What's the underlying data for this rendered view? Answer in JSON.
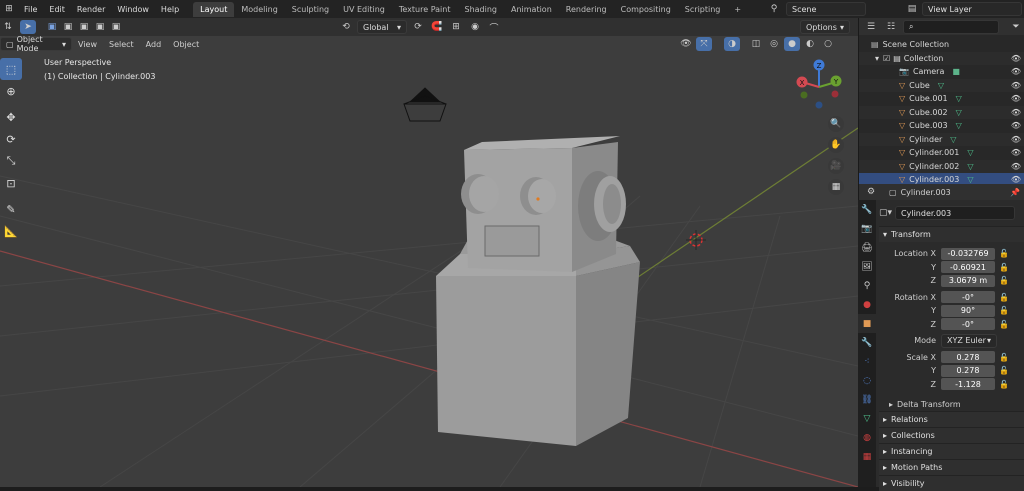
{
  "menu": {
    "items": [
      "File",
      "Edit",
      "Render",
      "Window",
      "Help"
    ]
  },
  "workspaces": {
    "tabs": [
      "Layout",
      "Modeling",
      "Sculpting",
      "UV Editing",
      "Texture Paint",
      "Shading",
      "Animation",
      "Rendering",
      "Compositing",
      "Scripting"
    ],
    "active": "Layout",
    "add": "+"
  },
  "scene": {
    "name": "Scene",
    "view_layer": "View Layer"
  },
  "header": {
    "mode": "Object Mode",
    "menus": [
      "View",
      "Select",
      "Add",
      "Object"
    ],
    "transform_orientation": "Global",
    "options": "Options"
  },
  "viewport": {
    "view_name": "User Perspective",
    "collection_info": "(1) Collection | Cylinder.003"
  },
  "gizmo": {
    "x": "X",
    "y": "Y",
    "z": "Z"
  },
  "outliner": {
    "search_placeholder": "",
    "root": "Scene Collection",
    "collection": "Collection",
    "items": [
      "Camera",
      "Cube",
      "Cube.001",
      "Cube.002",
      "Cube.003",
      "Cylinder",
      "Cylinder.001",
      "Cylinder.002",
      "Cylinder.003"
    ]
  },
  "properties": {
    "object_name": "Cylinder.003",
    "datablock_name": "Cylinder.003",
    "transform_title": "Transform",
    "location_label": "Location X",
    "location": {
      "x": "-0.032769",
      "y": "-0.60921",
      "z": "3.0679 m"
    },
    "rotation_label": "Rotation X",
    "rotation": {
      "x": "-0°",
      "y": "90°",
      "z": "-0°"
    },
    "mode_label": "Mode",
    "mode_value": "XYZ Euler",
    "scale_label": "Scale X",
    "scale": {
      "x": "0.278",
      "y": "0.278",
      "z": "-1.128"
    },
    "y_label": "Y",
    "z_label": "Z",
    "delta": "Delta Transform",
    "panels": [
      "Relations",
      "Collections",
      "Instancing",
      "Motion Paths",
      "Visibility"
    ]
  }
}
